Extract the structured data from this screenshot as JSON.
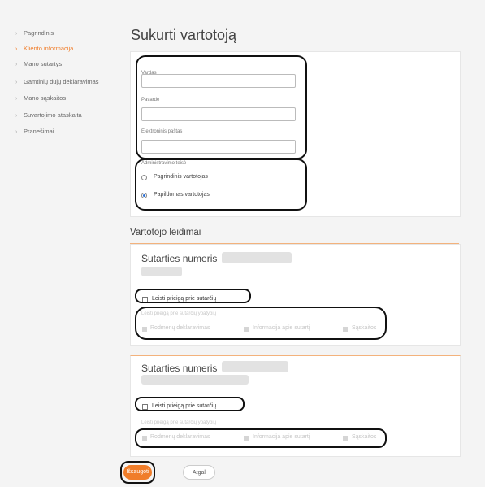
{
  "sidebar": {
    "items": [
      {
        "label": "Pagrindinis"
      },
      {
        "label": "Kliento informacija"
      },
      {
        "label": "Mano sutartys"
      },
      {
        "label": "Gamtinių dujų deklaravimas"
      },
      {
        "label": "Mano sąskaitos"
      },
      {
        "label": "Suvartojimo ataskaita"
      },
      {
        "label": "Pranešimai"
      }
    ],
    "chevron": "›"
  },
  "page": {
    "title": "Sukurti vartotoją"
  },
  "form": {
    "first_name_label": "Vardas",
    "first_name_value": "",
    "last_name_label": "Pavardė",
    "last_name_value": "",
    "email_label": "Elektroninis paštas",
    "email_value": "",
    "admin_rights_label": "Administravimo teisė",
    "radio_primary_label": "Pagrindinis vartotojas",
    "radio_additional_label": "Papildomas vartotojas",
    "selected_radio": "Papildomas vartotojas"
  },
  "permissions": {
    "title": "Vartotojo leidimai",
    "contracts": [
      {
        "title": "Sutarties numeris",
        "allow_label": "Leisti prieigą prie sutarčių",
        "features_label": "Leisti prieigą prie sutarčių ypatybių",
        "features": [
          "Rodmenų deklaravimas",
          "Informacija apie sutartį",
          "Sąskaitos"
        ]
      },
      {
        "title": "Sutarties numeris",
        "allow_label": "Leisti prieigą prie sutarčių",
        "features_label": "Leisti prieigą prie sutarčių ypatybių",
        "features": [
          "Rodmenų deklaravimas",
          "Informacija apie sutartį",
          "Sąskaitos"
        ]
      }
    ]
  },
  "actions": {
    "save_label": "Išsaugoti",
    "back_label": "Atgal"
  },
  "colors": {
    "accent": "#f07d2a",
    "annotation": "#111111",
    "radio_selected": "#2b6fd6"
  },
  "icons": {
    "nav": "chevron-right-icon"
  }
}
